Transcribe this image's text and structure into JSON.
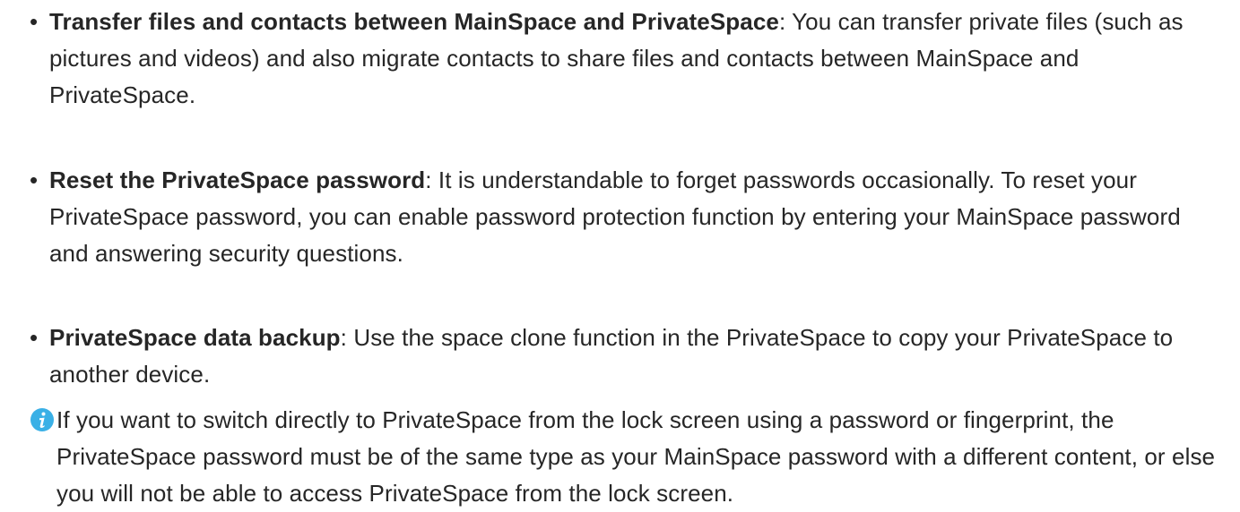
{
  "bullets": [
    {
      "term": "Transfer files and contacts between MainSpace and PrivateSpace",
      "body": ": You can transfer private files (such as pictures and videos) and also migrate contacts to share files and contacts between MainSpace and PrivateSpace."
    },
    {
      "term": "Reset the PrivateSpace password",
      "body": ": It is understandable to forget passwords occasionally. To reset your PrivateSpace password, you can enable password protection function by entering your MainSpace password and answering security questions."
    },
    {
      "term": "PrivateSpace data backup",
      "body": ": Use the space clone function in the PrivateSpace to copy your PrivateSpace to another device."
    }
  ],
  "note": {
    "icon": "info-icon",
    "icon_color": "#3ab0e6",
    "text": "If you want to switch directly to PrivateSpace from the lock screen using a password or fingerprint, the PrivateSpace password must be of the same type as your MainSpace password with a different content, or else you will not be able to access PrivateSpace from the lock screen."
  }
}
